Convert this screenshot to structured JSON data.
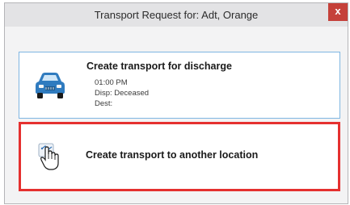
{
  "window": {
    "title": "Transport Request for: Adt, Orange",
    "close_label": "x"
  },
  "options": [
    {
      "label": "Create transport for discharge",
      "icon": "car-icon",
      "details": {
        "time": "01:00 PM",
        "disp": "Disp: Deceased",
        "dest": "Dest:"
      }
    },
    {
      "label": "Create transport to another location",
      "icon": "hand-pointer-icon",
      "highlight_color": "#e5302f"
    }
  ],
  "colors": {
    "car_body": "#2f7bbf",
    "highlight_border": "#e5302f",
    "card_border": "#7fb6e2"
  }
}
